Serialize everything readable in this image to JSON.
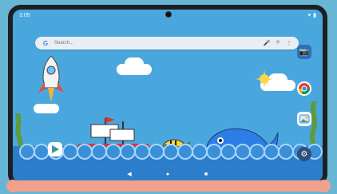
{
  "status": {
    "time": "3:05"
  },
  "search": {
    "placeholder": "Search..."
  },
  "apps": [
    {
      "name": "Google Play",
      "icon": "play-icon"
    },
    {
      "name": "Chrome",
      "icon": "chrome-icon"
    },
    {
      "name": "Gallery",
      "icon": "gallery-icon"
    },
    {
      "name": "Settings",
      "icon": "settings-icon"
    },
    {
      "name": "Camera",
      "icon": "camera-icon"
    }
  ],
  "colors": {
    "sky": "#4aa7dd",
    "sea": "#2c7dca",
    "pink": "#f0a18c"
  }
}
